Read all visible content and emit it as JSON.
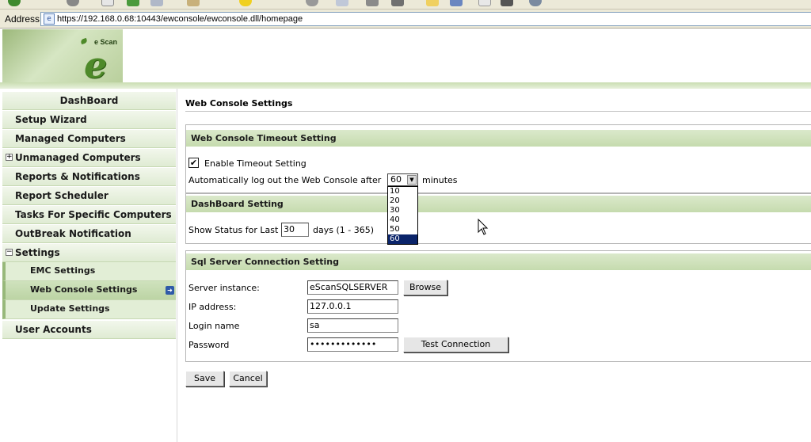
{
  "browser": {
    "address_label": "Address",
    "url": "https://192.168.0.68:10443/ewconsole/ewconsole.dll/homepage"
  },
  "brand": {
    "logo_text": "e Scan",
    "logo_letter": "e",
    "accent_color": "#c5dbae"
  },
  "sidebar": {
    "items": [
      {
        "label": "DashBoard"
      },
      {
        "label": "Setup Wizard"
      },
      {
        "label": "Managed Computers"
      },
      {
        "label": "Unmanaged Computers",
        "expander": "+"
      },
      {
        "label": "Reports & Notifications"
      },
      {
        "label": "Report Scheduler"
      },
      {
        "label": "Tasks For Specific Computers"
      },
      {
        "label": "OutBreak Notification"
      },
      {
        "label": "Settings",
        "expander": "−"
      },
      {
        "label": "EMC Settings"
      },
      {
        "label": "Web Console Settings",
        "icon": "arrow-right-icon",
        "active": true
      },
      {
        "label": "Update Settings"
      },
      {
        "label": "User Accounts"
      }
    ]
  },
  "main": {
    "title": "Web Console Settings",
    "timeout_section": {
      "heading": "Web Console Timeout Setting",
      "enable_label": "Enable Timeout Setting",
      "enabled": true,
      "logout_prefix": "Automatically log out the Web Console after",
      "logout_suffix": "minutes",
      "selected_minutes": "60",
      "options": [
        "10",
        "20",
        "30",
        "40",
        "50",
        "60"
      ]
    },
    "dashboard_section": {
      "heading": "DashBoard Setting",
      "status_label": "Show Status for Last",
      "status_days": "30",
      "status_suffix": "days (1 - 365)"
    },
    "sql_section": {
      "heading": "Sql Server Connection Setting",
      "server_label": "Server instance:",
      "server_value": "eScanSQLSERVER",
      "browse_label": "Browse",
      "ip_label": "IP address:",
      "ip_value": "127.0.0.1",
      "login_label": "Login name",
      "login_value": "sa",
      "password_label": "Password",
      "password_value": "•••••••••••••",
      "test_label": "Test Connection"
    },
    "save_label": "Save",
    "cancel_label": "Cancel"
  }
}
